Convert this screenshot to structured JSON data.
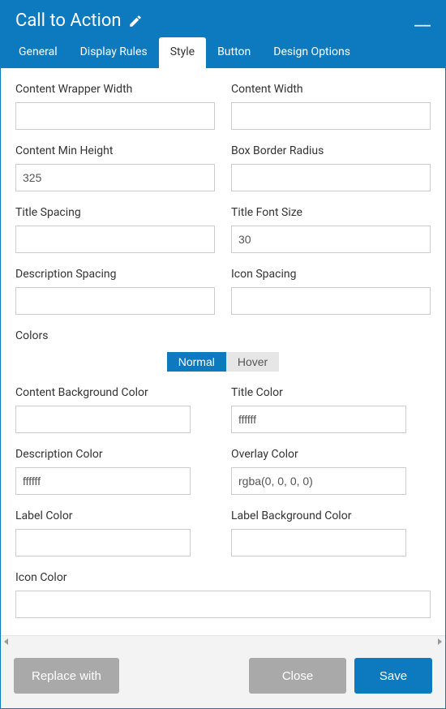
{
  "header": {
    "title": "Call to Action"
  },
  "tabs": [
    {
      "label": "General",
      "active": false
    },
    {
      "label": "Display Rules",
      "active": false
    },
    {
      "label": "Style",
      "active": true
    },
    {
      "label": "Button",
      "active": false
    },
    {
      "label": "Design Options",
      "active": false
    }
  ],
  "fields": {
    "content_wrapper_width": {
      "label": "Content Wrapper Width",
      "value": ""
    },
    "content_width": {
      "label": "Content Width",
      "value": ""
    },
    "content_min_height": {
      "label": "Content Min Height",
      "value": "325"
    },
    "box_border_radius": {
      "label": "Box Border Radius",
      "value": ""
    },
    "title_spacing": {
      "label": "Title Spacing",
      "value": ""
    },
    "title_font_size": {
      "label": "Title Font Size",
      "value": "30"
    },
    "description_spacing": {
      "label": "Description Spacing",
      "value": ""
    },
    "icon_spacing": {
      "label": "Icon Spacing",
      "value": ""
    }
  },
  "colors_section": {
    "label": "Colors",
    "toggle": {
      "normal": "Normal",
      "hover": "Hover",
      "active": "normal"
    },
    "content_background_color": {
      "label": "Content Background Color",
      "value": ""
    },
    "title_color": {
      "label": "Title Color",
      "value": "ffffff"
    },
    "description_color": {
      "label": "Description Color",
      "value": "ffffff"
    },
    "overlay_color": {
      "label": "Overlay Color",
      "value": "rgba(0, 0, 0, 0)"
    },
    "label_color": {
      "label": "Label Color",
      "value": ""
    },
    "label_background_color": {
      "label": "Label Background Color",
      "value": ""
    },
    "icon_color": {
      "label": "Icon Color",
      "value": ""
    }
  },
  "footer": {
    "replace_with": "Replace with",
    "close": "Close",
    "save": "Save"
  }
}
